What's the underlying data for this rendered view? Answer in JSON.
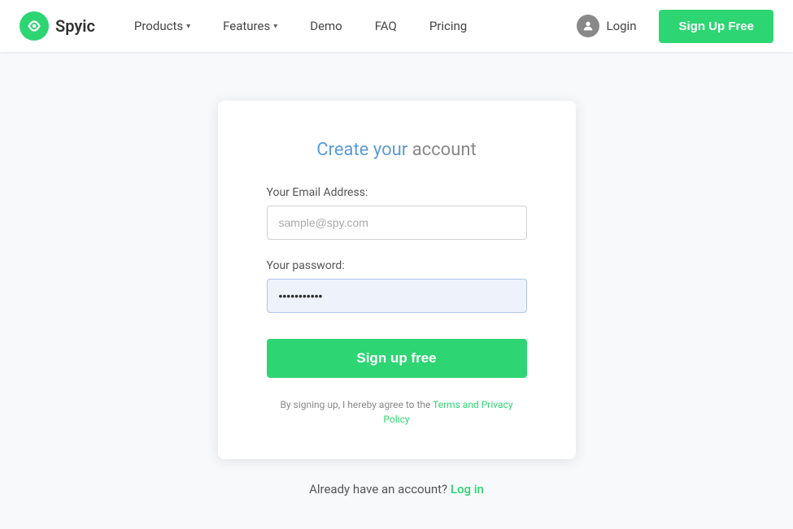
{
  "header": {
    "logo_text": "Spyic",
    "nav_items": [
      {
        "label": "Products",
        "has_dropdown": true
      },
      {
        "label": "Features",
        "has_dropdown": true
      },
      {
        "label": "Demo",
        "has_dropdown": false
      },
      {
        "label": "FAQ",
        "has_dropdown": false
      },
      {
        "label": "Pricing",
        "has_dropdown": false
      }
    ],
    "login_label": "Login",
    "signup_label": "Sign Up Free"
  },
  "form": {
    "title_part1": "Create your account",
    "email_label": "Your Email Address:",
    "email_placeholder": "sample@spy.com",
    "email_value": "",
    "password_label": "Your password:",
    "password_value": "••••••••••••",
    "submit_label": "Sign up free",
    "terms_text_before": "By signing up, I hereby agree to the ",
    "terms_link_label": "Terms and Privacy Policy",
    "already_text": "Already have an account?",
    "login_link_label": "Log in"
  }
}
